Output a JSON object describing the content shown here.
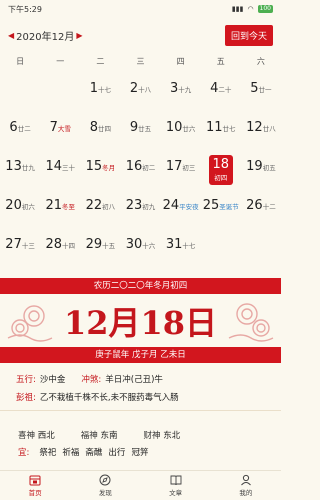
{
  "status": {
    "time": "下午5:29",
    "battery": "100"
  },
  "header": {
    "month_title": "2020年12月",
    "today_button": "回到今天"
  },
  "weekdays": [
    "日",
    "一",
    "二",
    "三",
    "四",
    "五",
    "六"
  ],
  "weeks": [
    [
      {
        "d": "",
        "s": ""
      },
      {
        "d": "",
        "s": ""
      },
      {
        "d": "1",
        "s": "十七"
      },
      {
        "d": "2",
        "s": "十八"
      },
      {
        "d": "3",
        "s": "十九"
      },
      {
        "d": "4",
        "s": "二十"
      },
      {
        "d": "5",
        "s": "廿一"
      }
    ],
    [
      {
        "d": "6",
        "s": "廿二"
      },
      {
        "d": "7",
        "s": "大雪",
        "c": "red"
      },
      {
        "d": "8",
        "s": "廿四"
      },
      {
        "d": "9",
        "s": "廿五"
      },
      {
        "d": "10",
        "s": "廿六"
      },
      {
        "d": "11",
        "s": "廿七"
      },
      {
        "d": "12",
        "s": "廿八"
      }
    ],
    [
      {
        "d": "13",
        "s": "廿九"
      },
      {
        "d": "14",
        "s": "三十"
      },
      {
        "d": "15",
        "s": "冬月",
        "c": "red"
      },
      {
        "d": "16",
        "s": "初二"
      },
      {
        "d": "17",
        "s": "初三"
      },
      {
        "d": "18",
        "s": "初四",
        "sel": true
      },
      {
        "d": "19",
        "s": "初五"
      }
    ],
    [
      {
        "d": "20",
        "s": "初六"
      },
      {
        "d": "21",
        "s": "冬至",
        "c": "red"
      },
      {
        "d": "22",
        "s": "初八"
      },
      {
        "d": "23",
        "s": "初九"
      },
      {
        "d": "24",
        "s": "平安夜",
        "c": "blue"
      },
      {
        "d": "25",
        "s": "圣诞节",
        "c": "blue"
      },
      {
        "d": "26",
        "s": "十二"
      }
    ],
    [
      {
        "d": "27",
        "s": "十三"
      },
      {
        "d": "28",
        "s": "十四"
      },
      {
        "d": "29",
        "s": "十五"
      },
      {
        "d": "30",
        "s": "十六"
      },
      {
        "d": "31",
        "s": "十七"
      },
      {
        "d": "",
        "s": ""
      },
      {
        "d": "",
        "s": ""
      }
    ]
  ],
  "detail": {
    "lunar_line": "农历二〇二〇年冬月初四",
    "big_date": "12月18日",
    "ganzhi_line": "庚子鼠年 戊子月 乙未日",
    "wuxing_label": "五行:",
    "wuxing_value": "沙中金",
    "chongsha_label": "冲煞:",
    "chongsha_value": "羊日冲(己丑)牛",
    "pengzu_label": "彭祖:",
    "pengzu_value": "乙不栽植千株不长,未不服药毒气入肠",
    "directions": [
      {
        "label": "喜神",
        "value": "西北"
      },
      {
        "label": "福神",
        "value": "东南"
      },
      {
        "label": "财神",
        "value": "东北"
      }
    ],
    "yi_label": "宜:",
    "yi_items": [
      "祭祀",
      "祈福",
      "斋醮",
      "出行",
      "冠笄"
    ]
  },
  "tabs": [
    {
      "label": "首页",
      "icon": "calendar-icon",
      "active": true
    },
    {
      "label": "发现",
      "icon": "compass-icon"
    },
    {
      "label": "文章",
      "icon": "book-icon"
    },
    {
      "label": "我的",
      "icon": "user-icon"
    }
  ],
  "colors": {
    "accent": "#d2161e",
    "background": "#fbf8ee",
    "holiday_blue": "#3a86c8"
  }
}
